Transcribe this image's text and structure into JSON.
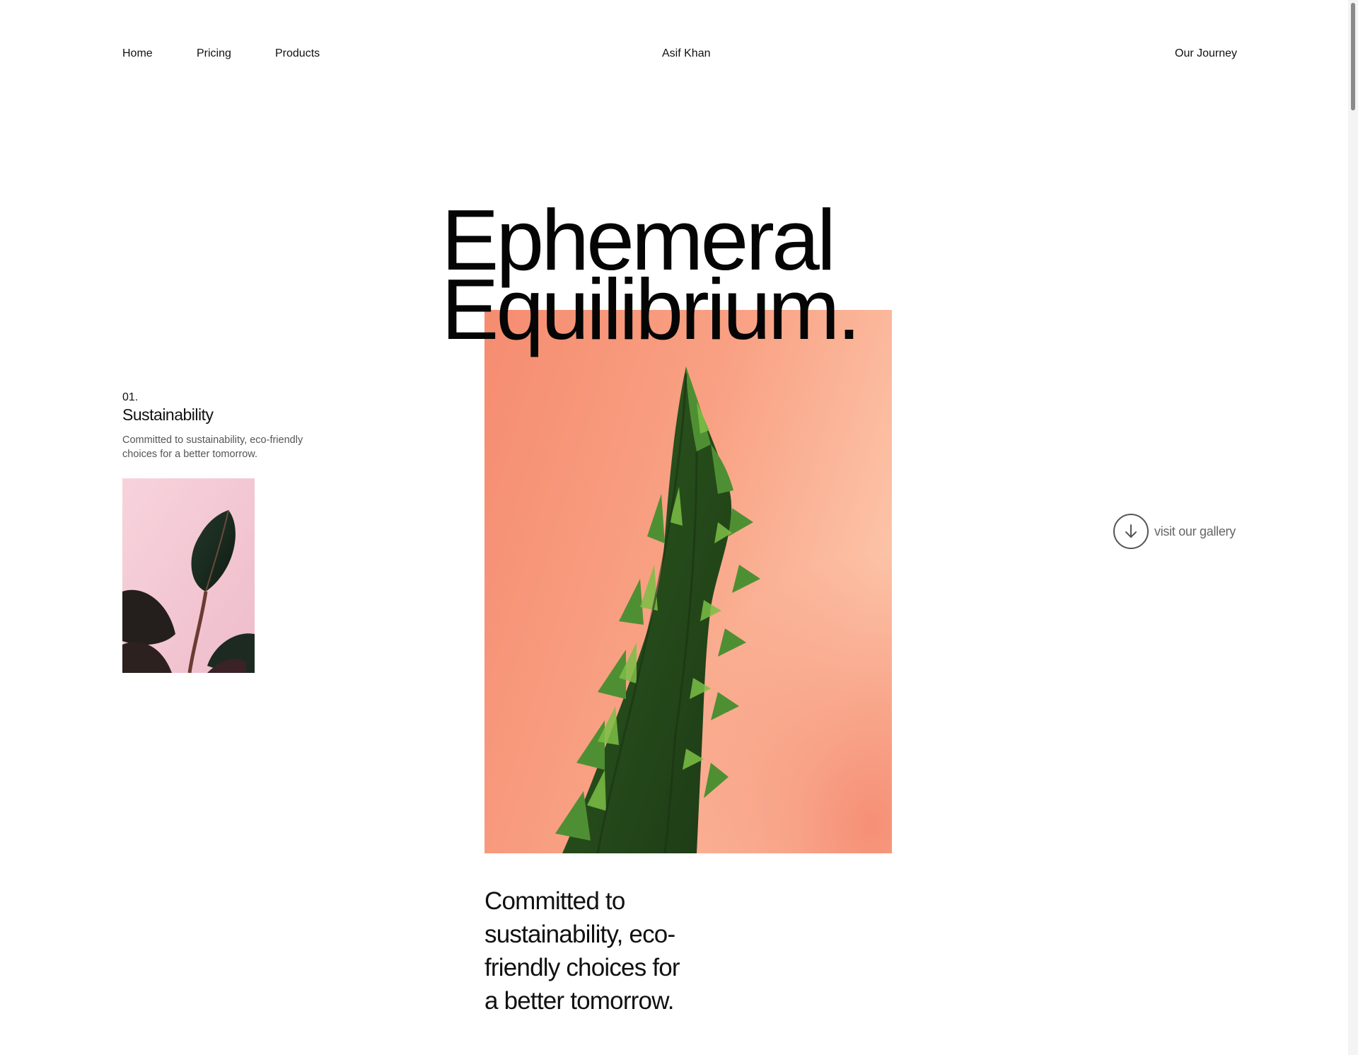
{
  "nav": {
    "home": "Home",
    "pricing": "Pricing",
    "products": "Products",
    "brand": "Asif Khan",
    "journey": "Our Journey"
  },
  "hero": {
    "title_line1": "Ephemeral",
    "title_line2": "Equilibrium."
  },
  "feature": {
    "number": "01.",
    "title": "Sustainability",
    "description": "Committed to sustainability, eco-friendly choices for a better tomorrow."
  },
  "gallery": {
    "label": "visit our gallery",
    "icon": "arrow-down-icon"
  },
  "quote": {
    "text": "Committed to sustainability, eco-friendly choices for a better tomorrow."
  },
  "colors": {
    "background": "#ffffff",
    "text": "#0a0a0a",
    "muted_text": "#666666",
    "coral": "#f99a7d",
    "pink": "#f3c7d2",
    "leaf_green": "#3f7a2c"
  }
}
